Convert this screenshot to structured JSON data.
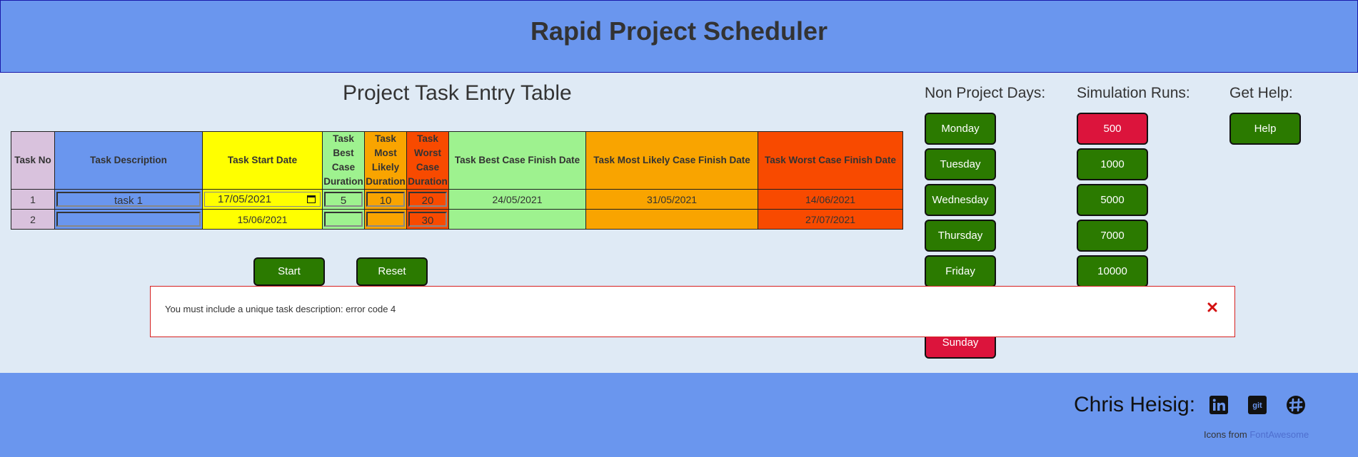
{
  "header": {
    "title": "Rapid Project Scheduler"
  },
  "table": {
    "title": "Project Task Entry Table",
    "headers": {
      "no": "Task No",
      "desc": "Task Description",
      "start": "Task Start Date",
      "best": [
        "Task",
        "Best",
        "Case",
        "Duration"
      ],
      "likely": [
        "Task",
        "Most",
        "Likely",
        "Duration"
      ],
      "worst": [
        "Task",
        "Worst",
        "Case",
        "Duration"
      ],
      "bestf": "Task Best Case Finish Date",
      "likelyf": "Task Most Likely Case Finish Date",
      "worstf": "Task Worst Case Finish Date"
    },
    "rows": [
      {
        "no": "1",
        "desc": "task 1",
        "start": "17/05/2021",
        "best": "5",
        "likely": "10",
        "worst": "20",
        "bestf": "24/05/2021",
        "likelyf": "31/05/2021",
        "worstf": "14/06/2021"
      },
      {
        "no": "2",
        "desc": "",
        "start": "15/06/2021",
        "best": "",
        "likely": "",
        "worst": "30",
        "bestf": "",
        "likelyf": "",
        "worstf": "27/07/2021"
      }
    ]
  },
  "actions": {
    "start": "Start",
    "reset": "Reset"
  },
  "non_project_days": {
    "title": "Non Project Days:",
    "days": [
      "Monday",
      "Tuesday",
      "Wednesday",
      "Thursday",
      "Friday",
      "Sunday"
    ],
    "active_color": "#2b7a00",
    "selected_color": "#dc143c"
  },
  "simulation_runs": {
    "title": "Simulation Runs:",
    "options": [
      "500",
      "1000",
      "5000",
      "7000",
      "10000"
    ],
    "selected": "500"
  },
  "help": {
    "title": "Get Help:",
    "button": "Help"
  },
  "alert": {
    "message": "You must include a unique task description: error code 4",
    "close_icon": "close-icon"
  },
  "footer": {
    "name": "Chris Heisig:",
    "icons": [
      "linkedin-icon",
      "git-icon",
      "slack-icon"
    ],
    "credit_prefix": "Icons from",
    "credit_link": "FontAwesome"
  }
}
